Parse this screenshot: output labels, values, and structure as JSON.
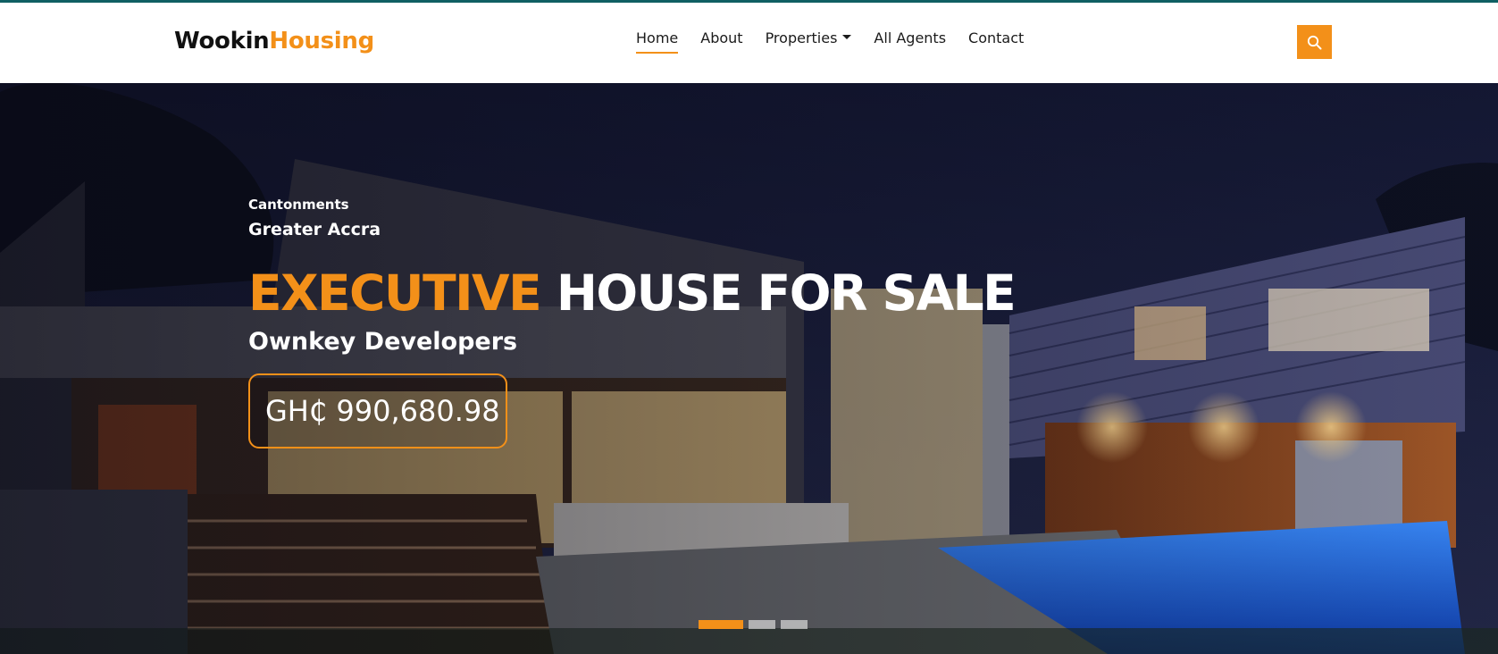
{
  "brand": {
    "part1": "Wookin",
    "part2": "Housing"
  },
  "nav": {
    "home": "Home",
    "about": "About",
    "properties": "Properties",
    "agents": "All Agents",
    "contact": "Contact"
  },
  "search": {
    "icon": "search-icon"
  },
  "hero": {
    "area": "Cantonments",
    "region": "Greater Accra",
    "headline_accent": "EXECUTIVE",
    "headline_rest": "HOUSE FOR SALE",
    "developer": "Ownkey Developers",
    "price": "GH₵ 990,680.98"
  },
  "slider": {
    "slide_count": 3,
    "active_index": 0
  },
  "colors": {
    "accent": "#f39019",
    "top_bar": "#0f5f63",
    "text_dark": "#1b1b1b"
  }
}
